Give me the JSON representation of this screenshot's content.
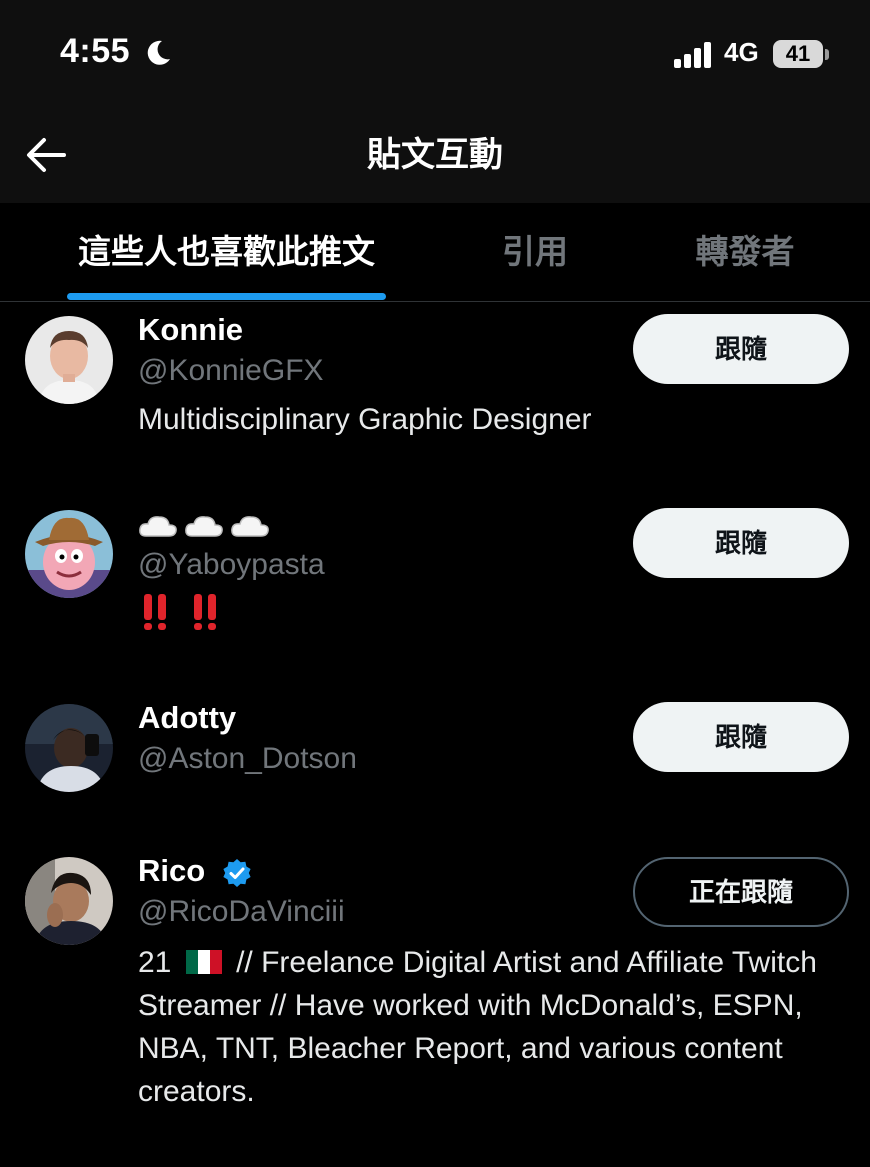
{
  "status_bar": {
    "time": "4:55",
    "network": "4G",
    "battery": "41"
  },
  "header": {
    "title": "貼文互動"
  },
  "tabs": [
    {
      "label": "這些人也喜歡此推文",
      "active": true
    },
    {
      "label": "引用",
      "active": false
    },
    {
      "label": "轉發者",
      "active": false
    }
  ],
  "users": [
    {
      "name": "Konnie",
      "handle": "@KonnieGFX",
      "bio": "Multidisciplinary Graphic Designer",
      "button": "跟隨",
      "verified": false
    },
    {
      "name": "☁️☁️☁️",
      "handle": "@Yaboypasta",
      "bio": "‼️‼️",
      "button": "跟隨",
      "verified": false
    },
    {
      "name": "Adotty",
      "handle": "@Aston_Dotson",
      "bio": "",
      "button": "跟隨",
      "verified": false
    },
    {
      "name": "Rico",
      "handle": "@RicoDaVinciii",
      "bio_prefix": "21",
      "bio_flag": "🇲🇽",
      "bio": "// Freelance Digital Artist and Affiliate Twitch Streamer // Have worked with McDonald’s, ESPN, NBA, TNT, Bleacher Report, and various content creators.",
      "button": "正在跟隨",
      "verified": true
    }
  ],
  "colors": {
    "accent": "#1d9bf0",
    "background": "#000000",
    "secondary_text": "#71767b",
    "alert_red": "#e0242b"
  },
  "icons": [
    "moon-icon",
    "signal-icon",
    "battery-icon",
    "back-arrow-icon",
    "verified-badge-icon",
    "cloud-emoji",
    "double-exclamation-emoji",
    "mexico-flag-emoji"
  ]
}
